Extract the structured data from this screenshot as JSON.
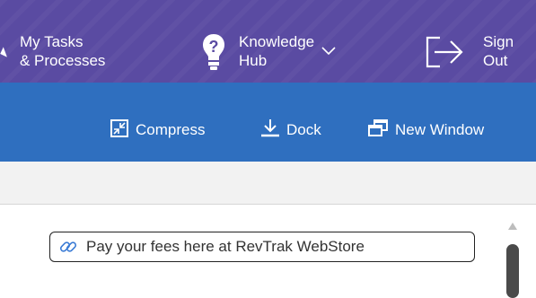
{
  "nav": {
    "my_tasks_label": "My Tasks\n& Processes",
    "knowledge_hub_label": "Knowledge\nHub",
    "sign_out_label": "Sign\nOut"
  },
  "toolbar": {
    "compress_label": "Compress",
    "dock_label": "Dock",
    "new_window_label": "New Window"
  },
  "content": {
    "link_text": "Pay your fees here at RevTrak WebStore"
  },
  "icons": {
    "knowledge_hub": "lightbulb-question-icon",
    "sign_out": "sign-out-arrow-icon",
    "compress": "compress-icon",
    "dock": "dock-icon",
    "new_window": "new-window-icon",
    "link": "link-icon"
  },
  "colors": {
    "nav_bg": "#5a4ba2",
    "toolbar_bg": "#2f6fbf",
    "strip_bg": "#f2f2f2"
  }
}
